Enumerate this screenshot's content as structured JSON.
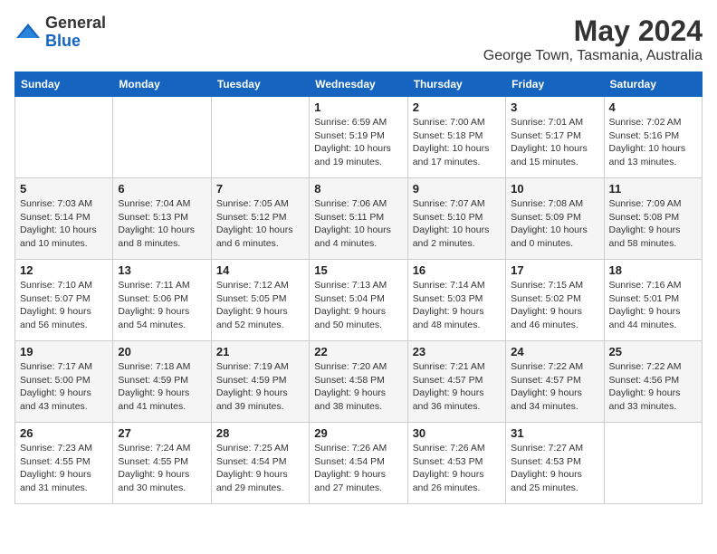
{
  "logo": {
    "general": "General",
    "blue": "Blue"
  },
  "title": "May 2024",
  "subtitle": "George Town, Tasmania, Australia",
  "days_of_week": [
    "Sunday",
    "Monday",
    "Tuesday",
    "Wednesday",
    "Thursday",
    "Friday",
    "Saturday"
  ],
  "weeks": [
    [
      {
        "day": "",
        "info": ""
      },
      {
        "day": "",
        "info": ""
      },
      {
        "day": "",
        "info": ""
      },
      {
        "day": "1",
        "info": "Sunrise: 6:59 AM\nSunset: 5:19 PM\nDaylight: 10 hours\nand 19 minutes."
      },
      {
        "day": "2",
        "info": "Sunrise: 7:00 AM\nSunset: 5:18 PM\nDaylight: 10 hours\nand 17 minutes."
      },
      {
        "day": "3",
        "info": "Sunrise: 7:01 AM\nSunset: 5:17 PM\nDaylight: 10 hours\nand 15 minutes."
      },
      {
        "day": "4",
        "info": "Sunrise: 7:02 AM\nSunset: 5:16 PM\nDaylight: 10 hours\nand 13 minutes."
      }
    ],
    [
      {
        "day": "5",
        "info": "Sunrise: 7:03 AM\nSunset: 5:14 PM\nDaylight: 10 hours\nand 10 minutes."
      },
      {
        "day": "6",
        "info": "Sunrise: 7:04 AM\nSunset: 5:13 PM\nDaylight: 10 hours\nand 8 minutes."
      },
      {
        "day": "7",
        "info": "Sunrise: 7:05 AM\nSunset: 5:12 PM\nDaylight: 10 hours\nand 6 minutes."
      },
      {
        "day": "8",
        "info": "Sunrise: 7:06 AM\nSunset: 5:11 PM\nDaylight: 10 hours\nand 4 minutes."
      },
      {
        "day": "9",
        "info": "Sunrise: 7:07 AM\nSunset: 5:10 PM\nDaylight: 10 hours\nand 2 minutes."
      },
      {
        "day": "10",
        "info": "Sunrise: 7:08 AM\nSunset: 5:09 PM\nDaylight: 10 hours\nand 0 minutes."
      },
      {
        "day": "11",
        "info": "Sunrise: 7:09 AM\nSunset: 5:08 PM\nDaylight: 9 hours\nand 58 minutes."
      }
    ],
    [
      {
        "day": "12",
        "info": "Sunrise: 7:10 AM\nSunset: 5:07 PM\nDaylight: 9 hours\nand 56 minutes."
      },
      {
        "day": "13",
        "info": "Sunrise: 7:11 AM\nSunset: 5:06 PM\nDaylight: 9 hours\nand 54 minutes."
      },
      {
        "day": "14",
        "info": "Sunrise: 7:12 AM\nSunset: 5:05 PM\nDaylight: 9 hours\nand 52 minutes."
      },
      {
        "day": "15",
        "info": "Sunrise: 7:13 AM\nSunset: 5:04 PM\nDaylight: 9 hours\nand 50 minutes."
      },
      {
        "day": "16",
        "info": "Sunrise: 7:14 AM\nSunset: 5:03 PM\nDaylight: 9 hours\nand 48 minutes."
      },
      {
        "day": "17",
        "info": "Sunrise: 7:15 AM\nSunset: 5:02 PM\nDaylight: 9 hours\nand 46 minutes."
      },
      {
        "day": "18",
        "info": "Sunrise: 7:16 AM\nSunset: 5:01 PM\nDaylight: 9 hours\nand 44 minutes."
      }
    ],
    [
      {
        "day": "19",
        "info": "Sunrise: 7:17 AM\nSunset: 5:00 PM\nDaylight: 9 hours\nand 43 minutes."
      },
      {
        "day": "20",
        "info": "Sunrise: 7:18 AM\nSunset: 4:59 PM\nDaylight: 9 hours\nand 41 minutes."
      },
      {
        "day": "21",
        "info": "Sunrise: 7:19 AM\nSunset: 4:59 PM\nDaylight: 9 hours\nand 39 minutes."
      },
      {
        "day": "22",
        "info": "Sunrise: 7:20 AM\nSunset: 4:58 PM\nDaylight: 9 hours\nand 38 minutes."
      },
      {
        "day": "23",
        "info": "Sunrise: 7:21 AM\nSunset: 4:57 PM\nDaylight: 9 hours\nand 36 minutes."
      },
      {
        "day": "24",
        "info": "Sunrise: 7:22 AM\nSunset: 4:57 PM\nDaylight: 9 hours\nand 34 minutes."
      },
      {
        "day": "25",
        "info": "Sunrise: 7:22 AM\nSunset: 4:56 PM\nDaylight: 9 hours\nand 33 minutes."
      }
    ],
    [
      {
        "day": "26",
        "info": "Sunrise: 7:23 AM\nSunset: 4:55 PM\nDaylight: 9 hours\nand 31 minutes."
      },
      {
        "day": "27",
        "info": "Sunrise: 7:24 AM\nSunset: 4:55 PM\nDaylight: 9 hours\nand 30 minutes."
      },
      {
        "day": "28",
        "info": "Sunrise: 7:25 AM\nSunset: 4:54 PM\nDaylight: 9 hours\nand 29 minutes."
      },
      {
        "day": "29",
        "info": "Sunrise: 7:26 AM\nSunset: 4:54 PM\nDaylight: 9 hours\nand 27 minutes."
      },
      {
        "day": "30",
        "info": "Sunrise: 7:26 AM\nSunset: 4:53 PM\nDaylight: 9 hours\nand 26 minutes."
      },
      {
        "day": "31",
        "info": "Sunrise: 7:27 AM\nSunset: 4:53 PM\nDaylight: 9 hours\nand 25 minutes."
      },
      {
        "day": "",
        "info": ""
      }
    ]
  ]
}
